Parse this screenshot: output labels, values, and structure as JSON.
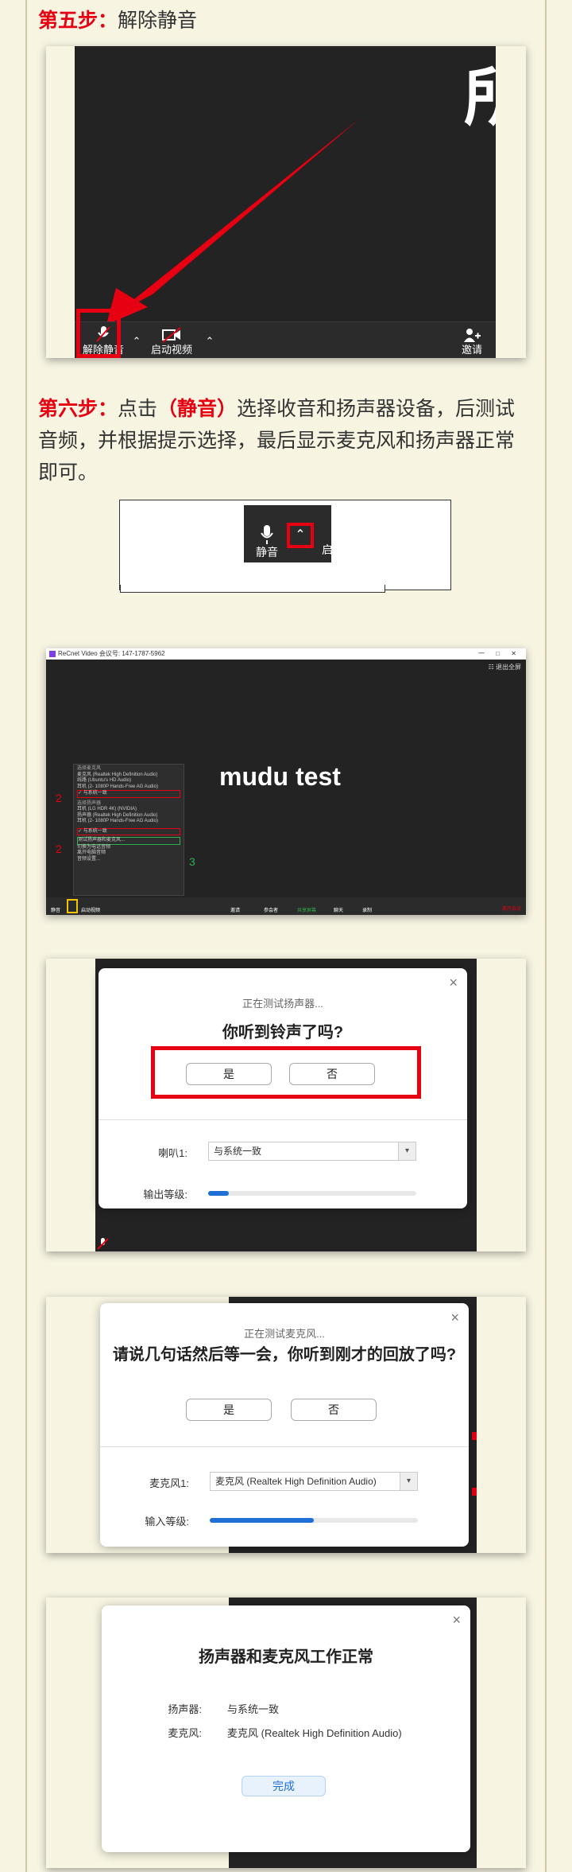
{
  "step5": {
    "label": "第五步：",
    "text": "解除静音",
    "screenshot": {
      "big_char": "所",
      "unmute_label": "解除静音",
      "video_label": "启动视频",
      "invite_label": "邀请"
    }
  },
  "step6": {
    "label": "第六步：",
    "text_before": "点击",
    "highlight": "（静音）",
    "text_after": "选择收音和扬声器设备，后测试音频，并根据提示选择，最后显示麦克风和扬声器正常即可。",
    "crop": {
      "mute_label": "静音",
      "side_char": "启"
    }
  },
  "menu_shot": {
    "title": "ReCnet Video 会议号: 147-1787-5962",
    "title_buttons": "一 □ ✕",
    "meeting_name": "mudu test",
    "top_right": "☷ 退出全屏",
    "menu_items": [
      "选择麦克风",
      "麦克风 (Realtek High Definition Audio)",
      "线路 (Ubuntu's HD Audio)",
      "耳机 (2- 1080P Hands-Free AG Audio)",
      "✓ 与系统一致",
      "选择扬声器",
      "耳机 (LG HDR 4K) (NVIDIA)",
      "扬声器 (Realtek High Definition Audio)",
      "耳机 (2- 1080P Hands-Free AG Audio)",
      "✓ 与系统一致",
      "测试扬声器和麦克风...",
      "切换为电话音频",
      "离开电脑音频",
      "音频设置..."
    ],
    "annotations": [
      "2",
      "2",
      "3"
    ],
    "toolbar": [
      "静音",
      "",
      "启动视频",
      "邀请",
      "参会者",
      "共享屏幕",
      "聊天",
      "录制",
      "离开会议"
    ]
  },
  "speaker_test": {
    "subtitle": "正在测试扬声器...",
    "question": "你听到铃声了吗?",
    "yes": "是",
    "no": "否",
    "speaker_label": "喇叭1:",
    "speaker_value": "与系统一致",
    "output_label": "输出等级:",
    "output_level": 0.1,
    "close": "×"
  },
  "mic_test": {
    "subtitle": "正在测试麦克风...",
    "question": "请说几句话然后等一会，你听到刚才的回放了吗?",
    "yes": "是",
    "no": "否",
    "mic_label": "麦克风1:",
    "mic_value": "麦克风 (Realtek High Definition Audio)",
    "input_label": "输入等级:",
    "input_level": 0.5,
    "close": "×"
  },
  "result": {
    "title": "扬声器和麦克风工作正常",
    "speaker_label": "扬声器:",
    "speaker_value": "与系统一致",
    "mic_label": "麦克风:",
    "mic_value": "麦克风 (Realtek High Definition Audio)",
    "done": "完成",
    "close": "×"
  },
  "colors": {
    "accent_red": "#e60012",
    "zoom_dark": "#232323",
    "level_blue": "#1f6fd6"
  }
}
